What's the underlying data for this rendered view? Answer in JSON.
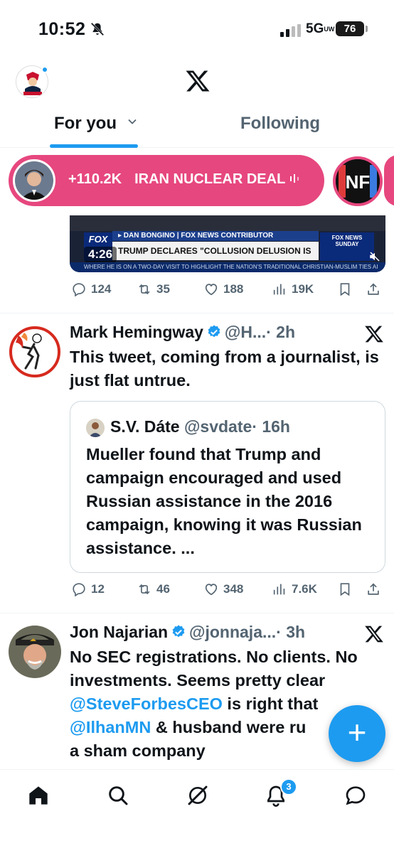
{
  "status": {
    "time": "10:52",
    "network": "5G",
    "network_sub": "UW",
    "battery": "76"
  },
  "header": {
    "avatar": "profile-avatar",
    "logo": "x-logo"
  },
  "tabs": [
    {
      "label": "For you",
      "active": true
    },
    {
      "label": "Following",
      "active": false
    }
  ],
  "live": {
    "count": "+110.2K",
    "topic": "IRAN NUCLEAR DEAL",
    "second_host": "NF"
  },
  "video": {
    "duration": "4:26",
    "chyron_name": "▸ DAN BONGINO | FOX NEWS CONTRIBUTOR",
    "chyron_headline": "TRUMP DECLARES \"COLLUSION DELUSION IS OVER\"",
    "chyron_ticker": "WHERE HE IS ON A TWO-DAY VISIT TO HIGHLIGHT THE NATION'S TRADITIONAL CHRISTIAN-MUSLIM TIES AI",
    "channel": "FOX",
    "show": "FOX NEWS SUNDAY"
  },
  "post1_actions": {
    "replies": "124",
    "reposts": "35",
    "likes": "188",
    "views": "19K"
  },
  "tweet1": {
    "name": "Mark Hemingway",
    "handle": "@H...",
    "time": "· 2h",
    "text": "This tweet, coming from a journalist, is just flat untrue.",
    "quote": {
      "name": "S.V. Dáte",
      "handle": "@svdate",
      "time": "· 16h",
      "text": "Mueller found that Trump and campaign encouraged and used Russian assistance in the 2016 campaign, knowing it was Russian assistance. ..."
    },
    "actions": {
      "replies": "12",
      "reposts": "46",
      "likes": "348",
      "views": "7.6K"
    }
  },
  "tweet2": {
    "name": "Jon Najarian",
    "handle": "@jonnaja...",
    "time": "· 3h",
    "text_part1": "No SEC registrations. No clients. No investments. Seems pretty clear ",
    "mention1": "@SteveForbesCEO",
    "text_part2": " is right that ",
    "mention2": "@IlhanMN",
    "text_part3": " & husband were ru",
    "text_part4": "a sham company"
  },
  "fab": {
    "label": "+"
  },
  "bottom_nav": {
    "items": [
      "home-icon",
      "search-icon",
      "grok-icon",
      "notifications-icon",
      "messages-icon"
    ],
    "notifications_badge": "3"
  },
  "colors": {
    "accent": "#1d9bf0",
    "live_banner": "#e6477e",
    "secondary_text": "#536471"
  }
}
